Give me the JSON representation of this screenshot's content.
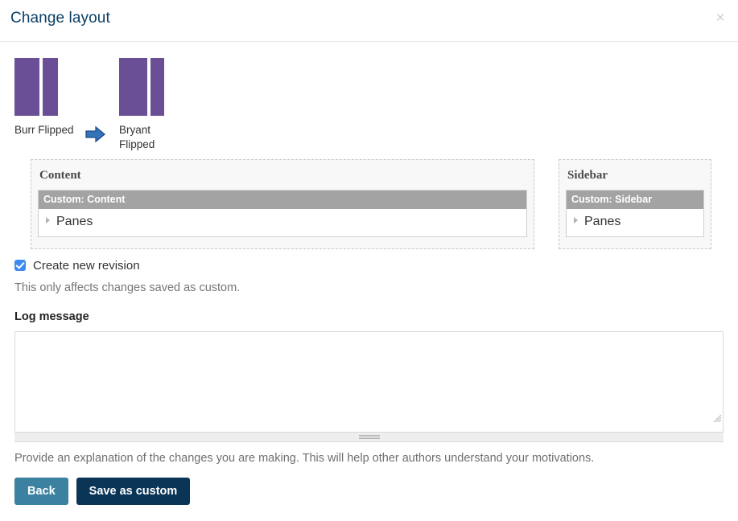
{
  "dialog": {
    "title": "Change layout",
    "close_icon": "close-icon",
    "close_glyph": "×"
  },
  "layout_change": {
    "from": {
      "name": "Burr Flipped",
      "thumbnail_color": "#6a4e96",
      "columns": [
        31,
        19
      ]
    },
    "arrow_icon": "arrow-right-icon",
    "arrow_color": "#2f6cb3",
    "to": {
      "name": "Bryant Flipped",
      "thumbnail_color": "#6a4e96",
      "columns": [
        35,
        17
      ]
    }
  },
  "regions": [
    {
      "title": "Content",
      "block_title": "Custom: Content",
      "block_header_color": "#a3a3a3",
      "items": [
        {
          "label": "Panes",
          "disclosure": "triangle-right-icon"
        }
      ]
    },
    {
      "title": "Sidebar",
      "block_title": "Custom: Sidebar",
      "block_header_color": "#a3a3a3",
      "items": [
        {
          "label": "Panes",
          "disclosure": "triangle-right-icon"
        }
      ]
    }
  ],
  "form": {
    "revision": {
      "label": "Create new revision",
      "checked": true,
      "checkbox_color": "#3d8bf2",
      "description": "This only affects changes saved as custom."
    },
    "log_message": {
      "label": "Log message",
      "value": "",
      "placeholder": "",
      "help": "Provide an explanation of the changes you are making. This will help other authors understand your motivations."
    }
  },
  "actions": {
    "back_label": "Back",
    "back_color": "#3d81a0",
    "save_label": "Save as custom",
    "save_color": "#0b3557"
  }
}
